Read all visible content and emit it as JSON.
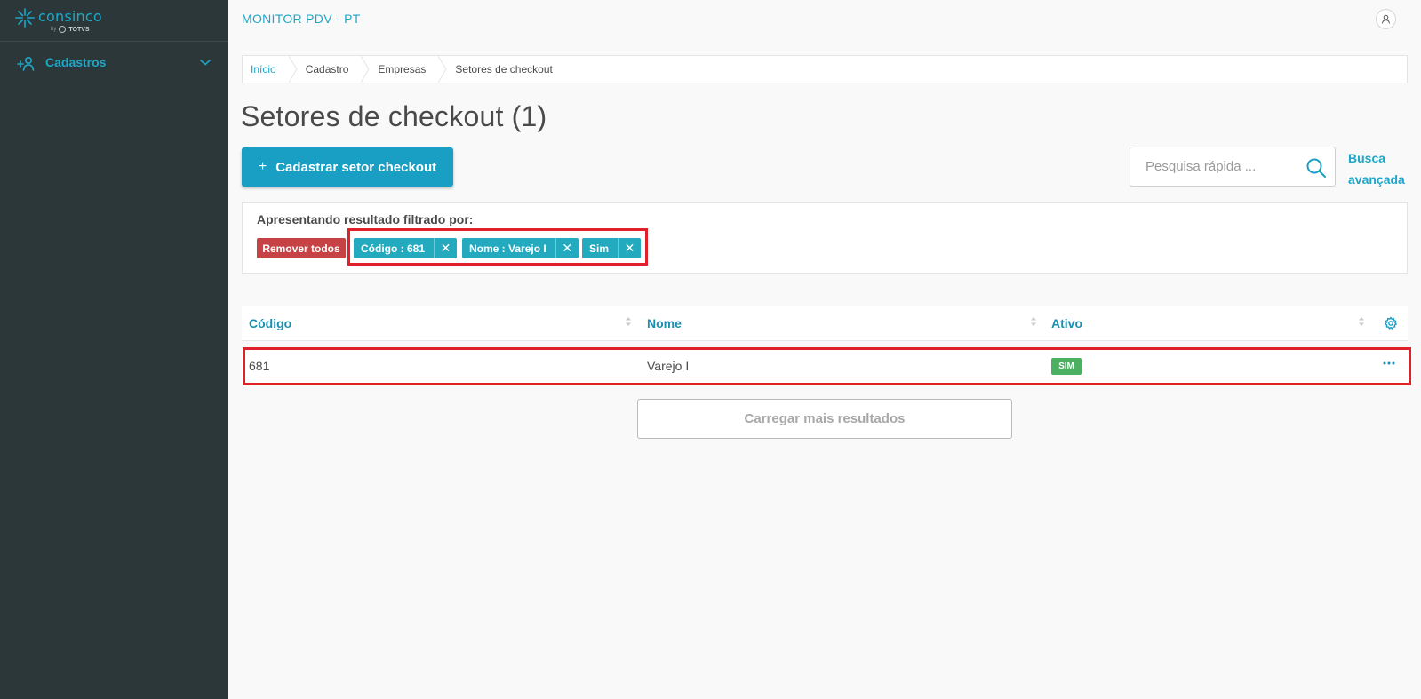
{
  "sidebar": {
    "logo": {
      "name": "consinco",
      "by": "by",
      "partner": "TOTVS"
    },
    "items": [
      {
        "label": "Cadastros",
        "icon": "add-user-icon"
      }
    ]
  },
  "header": {
    "app_title": "MONITOR PDV - PT"
  },
  "breadcrumb": [
    "Início",
    "Cadastro",
    "Empresas",
    "Setores de checkout"
  ],
  "page": {
    "title": "Setores de checkout (1)"
  },
  "toolbar": {
    "primary_button": "Cadastrar setor checkout",
    "search_placeholder": "Pesquisa rápida ...",
    "advanced_search_line1": "Busca",
    "advanced_search_line2": "avançada"
  },
  "filters": {
    "title": "Apresentando resultado filtrado por:",
    "remove_all": "Remover todos",
    "chips": [
      {
        "label": "Código : 681"
      },
      {
        "label": "Nome : Varejo I"
      },
      {
        "label": "Sim"
      }
    ]
  },
  "table": {
    "columns": [
      "Código",
      "Nome",
      "Ativo"
    ],
    "rows": [
      {
        "codigo": "681",
        "nome": "Varejo I",
        "ativo": "SIM"
      }
    ]
  },
  "load_more": "Carregar mais resultados",
  "colors": {
    "accent": "#1ea7c8",
    "sidebar_bg": "#2c3739",
    "danger": "#c64244",
    "chip": "#24aabf",
    "success": "#4caf62",
    "highlight": "#e0202a"
  }
}
